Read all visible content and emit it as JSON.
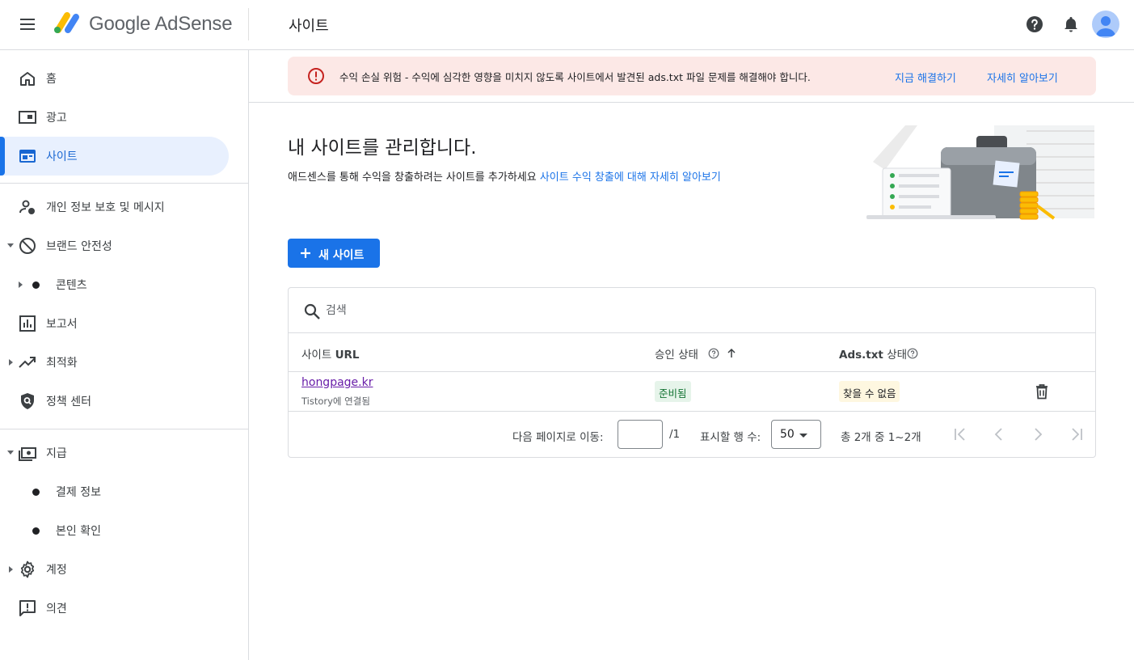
{
  "header": {
    "logo_text": "Google AdSense",
    "page_title": "사이트"
  },
  "sidebar": {
    "items": [
      {
        "label": "홈",
        "icon": "home-icon"
      },
      {
        "label": "광고",
        "icon": "ads-icon"
      },
      {
        "label": "사이트",
        "icon": "sites-icon",
        "active": true
      },
      {
        "label": "개인 정보 보호 및 메시지",
        "icon": "privacy-messaging-icon"
      },
      {
        "label": "브랜드 안전성",
        "icon": "block-icon"
      },
      {
        "label": "콘텐츠",
        "icon": "bullet-icon"
      },
      {
        "label": "보고서",
        "icon": "reports-icon"
      },
      {
        "label": "최적화",
        "icon": "trending-icon"
      },
      {
        "label": "정책 센터",
        "icon": "policy-shield-icon"
      },
      {
        "label": "지급",
        "icon": "payments-icon"
      },
      {
        "label": "결제 정보",
        "icon": "bullet-icon"
      },
      {
        "label": "본인 확인",
        "icon": "bullet-icon"
      },
      {
        "label": "계정",
        "icon": "gear-icon"
      },
      {
        "label": "의견",
        "icon": "feedback-icon"
      }
    ]
  },
  "alert": {
    "message": "수익 손실 위험 - 수익에 심각한 영향을 미치지 않도록 사이트에서 발견된 ads.txt 파일 문제를 해결해야 합니다.",
    "action_fix": "지금 해결하기",
    "action_learn": "자세히 알아보기",
    "color": "#fce8e6"
  },
  "main": {
    "heading": "내 사이트를 관리합니다.",
    "subtitle": "애드센스를 통해 수익을 창출하려는 사이트를 추가하세요",
    "subtitle_link": "사이트 수익 창출에 대해 자세히 알아보기",
    "new_site_button": "새 사이트"
  },
  "table": {
    "search_placeholder": "검색",
    "columns": {
      "site_url_prefix": "사이트",
      "site_url_bold": "URL",
      "approval_status": "승인 상태",
      "ads_txt_bold": "Ads.txt",
      "ads_txt_suffix": "상태"
    },
    "rows": [
      {
        "site": "hongpage.kr",
        "site_sub": "Tistory에 연결됨",
        "approval": "준비됨",
        "ads_txt": "찾을 수 없음"
      }
    ],
    "pagination": {
      "goto_label": "다음 페이지로 이동:",
      "goto_value": "",
      "total_pages": "/1",
      "rows_label": "표시할 행 수:",
      "rows_value": "50",
      "summary": "총 2개 중 1~2개"
    }
  },
  "colors": {
    "accent": "#1a73e8",
    "active_bg": "#e8f0fe",
    "ready_badge": "#e6f4ea",
    "notfound_badge": "#fef7e0"
  }
}
